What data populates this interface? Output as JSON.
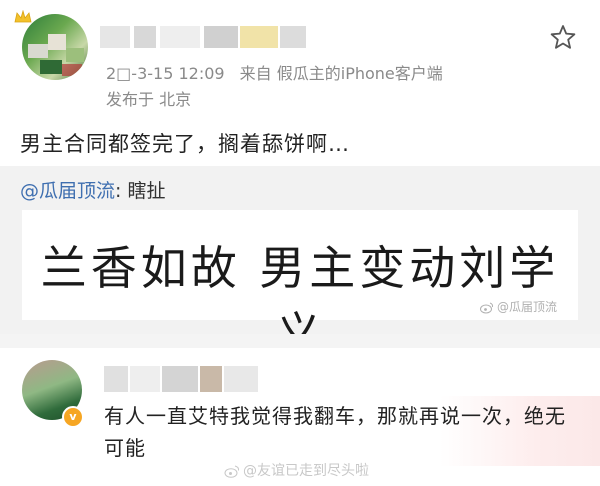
{
  "post1": {
    "time": "2□-3-15 12:09",
    "source": "来自 假瓜主的iPhone客户端",
    "location": "发布于 北京",
    "body": "男主合同都签完了，搁着舔饼啊…"
  },
  "repost": {
    "at_user": "@瓜届顶流",
    "separator": ":",
    "title": " 瞎扯",
    "card_text": "兰香如故 男主变动刘学义",
    "watermark": "@瓜届顶流"
  },
  "post2": {
    "body": "有人一直艾特我觉得我翻车，那就再说一次，绝无可能",
    "badge": "v",
    "watermark": "@友谊已走到尽头啦"
  },
  "colors": {
    "link": "#3f6fb0",
    "meta": "#8a8a8a",
    "repost_bg": "#f2f2f2"
  },
  "icons": [
    "crown-icon",
    "star-icon",
    "weibo-logo-icon",
    "verified-badge-icon"
  ]
}
